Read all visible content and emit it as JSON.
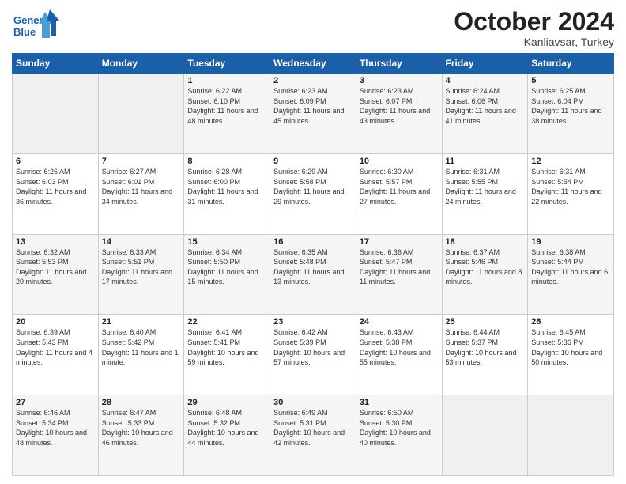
{
  "header": {
    "logo_line1": "General",
    "logo_line2": "Blue",
    "month": "October 2024",
    "location": "Kanliavsar, Turkey"
  },
  "weekdays": [
    "Sunday",
    "Monday",
    "Tuesday",
    "Wednesday",
    "Thursday",
    "Friday",
    "Saturday"
  ],
  "weeks": [
    [
      {
        "day": "",
        "info": ""
      },
      {
        "day": "",
        "info": ""
      },
      {
        "day": "1",
        "info": "Sunrise: 6:22 AM\nSunset: 6:10 PM\nDaylight: 11 hours and 48 minutes."
      },
      {
        "day": "2",
        "info": "Sunrise: 6:23 AM\nSunset: 6:09 PM\nDaylight: 11 hours and 45 minutes."
      },
      {
        "day": "3",
        "info": "Sunrise: 6:23 AM\nSunset: 6:07 PM\nDaylight: 11 hours and 43 minutes."
      },
      {
        "day": "4",
        "info": "Sunrise: 6:24 AM\nSunset: 6:06 PM\nDaylight: 11 hours and 41 minutes."
      },
      {
        "day": "5",
        "info": "Sunrise: 6:25 AM\nSunset: 6:04 PM\nDaylight: 11 hours and 38 minutes."
      }
    ],
    [
      {
        "day": "6",
        "info": "Sunrise: 6:26 AM\nSunset: 6:03 PM\nDaylight: 11 hours and 36 minutes."
      },
      {
        "day": "7",
        "info": "Sunrise: 6:27 AM\nSunset: 6:01 PM\nDaylight: 11 hours and 34 minutes."
      },
      {
        "day": "8",
        "info": "Sunrise: 6:28 AM\nSunset: 6:00 PM\nDaylight: 11 hours and 31 minutes."
      },
      {
        "day": "9",
        "info": "Sunrise: 6:29 AM\nSunset: 5:58 PM\nDaylight: 11 hours and 29 minutes."
      },
      {
        "day": "10",
        "info": "Sunrise: 6:30 AM\nSunset: 5:57 PM\nDaylight: 11 hours and 27 minutes."
      },
      {
        "day": "11",
        "info": "Sunrise: 6:31 AM\nSunset: 5:55 PM\nDaylight: 11 hours and 24 minutes."
      },
      {
        "day": "12",
        "info": "Sunrise: 6:31 AM\nSunset: 5:54 PM\nDaylight: 11 hours and 22 minutes."
      }
    ],
    [
      {
        "day": "13",
        "info": "Sunrise: 6:32 AM\nSunset: 5:53 PM\nDaylight: 11 hours and 20 minutes."
      },
      {
        "day": "14",
        "info": "Sunrise: 6:33 AM\nSunset: 5:51 PM\nDaylight: 11 hours and 17 minutes."
      },
      {
        "day": "15",
        "info": "Sunrise: 6:34 AM\nSunset: 5:50 PM\nDaylight: 11 hours and 15 minutes."
      },
      {
        "day": "16",
        "info": "Sunrise: 6:35 AM\nSunset: 5:48 PM\nDaylight: 11 hours and 13 minutes."
      },
      {
        "day": "17",
        "info": "Sunrise: 6:36 AM\nSunset: 5:47 PM\nDaylight: 11 hours and 11 minutes."
      },
      {
        "day": "18",
        "info": "Sunrise: 6:37 AM\nSunset: 5:46 PM\nDaylight: 11 hours and 8 minutes."
      },
      {
        "day": "19",
        "info": "Sunrise: 6:38 AM\nSunset: 5:44 PM\nDaylight: 11 hours and 6 minutes."
      }
    ],
    [
      {
        "day": "20",
        "info": "Sunrise: 6:39 AM\nSunset: 5:43 PM\nDaylight: 11 hours and 4 minutes."
      },
      {
        "day": "21",
        "info": "Sunrise: 6:40 AM\nSunset: 5:42 PM\nDaylight: 11 hours and 1 minute."
      },
      {
        "day": "22",
        "info": "Sunrise: 6:41 AM\nSunset: 5:41 PM\nDaylight: 10 hours and 59 minutes."
      },
      {
        "day": "23",
        "info": "Sunrise: 6:42 AM\nSunset: 5:39 PM\nDaylight: 10 hours and 57 minutes."
      },
      {
        "day": "24",
        "info": "Sunrise: 6:43 AM\nSunset: 5:38 PM\nDaylight: 10 hours and 55 minutes."
      },
      {
        "day": "25",
        "info": "Sunrise: 6:44 AM\nSunset: 5:37 PM\nDaylight: 10 hours and 53 minutes."
      },
      {
        "day": "26",
        "info": "Sunrise: 6:45 AM\nSunset: 5:36 PM\nDaylight: 10 hours and 50 minutes."
      }
    ],
    [
      {
        "day": "27",
        "info": "Sunrise: 6:46 AM\nSunset: 5:34 PM\nDaylight: 10 hours and 48 minutes."
      },
      {
        "day": "28",
        "info": "Sunrise: 6:47 AM\nSunset: 5:33 PM\nDaylight: 10 hours and 46 minutes."
      },
      {
        "day": "29",
        "info": "Sunrise: 6:48 AM\nSunset: 5:32 PM\nDaylight: 10 hours and 44 minutes."
      },
      {
        "day": "30",
        "info": "Sunrise: 6:49 AM\nSunset: 5:31 PM\nDaylight: 10 hours and 42 minutes."
      },
      {
        "day": "31",
        "info": "Sunrise: 6:50 AM\nSunset: 5:30 PM\nDaylight: 10 hours and 40 minutes."
      },
      {
        "day": "",
        "info": ""
      },
      {
        "day": "",
        "info": ""
      }
    ]
  ]
}
